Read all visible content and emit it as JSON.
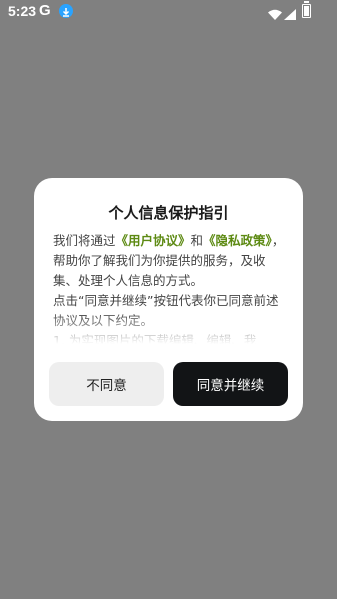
{
  "status_bar": {
    "time": "5:23",
    "g_icon": "G"
  },
  "dialog": {
    "title": "个人信息保护指引",
    "body": {
      "seg1": "我们将通过",
      "link1": "《用户协议》",
      "seg2": "和",
      "link2": "《隐私政策》",
      "seg3": "，帮助你了解我们为你提供的服务，及收集、处理个人信息的方式。",
      "para2": "点击“同意并继续”按钮代表你已同意前述协议及以下约定。",
      "para3": "1. 为实现图片的下载编辑、编辑、我"
    },
    "disagree_label": "不同意",
    "agree_label": "同意并继续"
  }
}
